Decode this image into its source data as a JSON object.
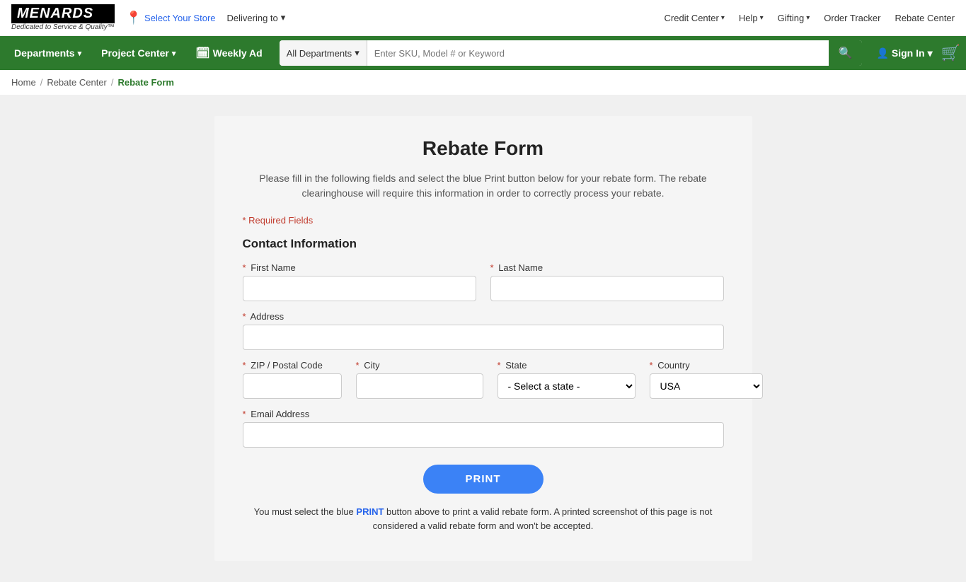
{
  "topbar": {
    "logo": "MENARDS",
    "logo_reg": "®",
    "tagline": "Dedicated to Service & Quality™",
    "store_select": "Select Your Store",
    "delivering_to": "Delivering to",
    "nav_right": [
      {
        "label": "Credit Center",
        "has_chevron": true
      },
      {
        "label": "Help",
        "has_chevron": true
      },
      {
        "label": "Gifting",
        "has_chevron": true
      },
      {
        "label": "Order Tracker",
        "has_chevron": false
      },
      {
        "label": "Rebate Center",
        "has_chevron": false
      }
    ]
  },
  "navbar": {
    "departments": "Departments",
    "project_center": "Project Center",
    "weekly_ad": "Weekly Ad",
    "search_dept": "All Departments",
    "search_placeholder": "Enter SKU, Model # or Keyword",
    "signin": "Sign In"
  },
  "breadcrumb": {
    "home": "Home",
    "rebate_center": "Rebate Center",
    "current": "Rebate Form"
  },
  "form": {
    "title": "Rebate Form",
    "description": "Please fill in the following fields and select the blue Print button below for your rebate form. The rebate clearinghouse will require this information in order to correctly process your rebate.",
    "required_note": "* Required Fields",
    "section_title": "Contact Information",
    "fields": {
      "first_name_label": "First Name",
      "last_name_label": "Last Name",
      "address_label": "Address",
      "zip_label": "ZIP / Postal Code",
      "city_label": "City",
      "state_label": "State",
      "state_placeholder": "- Select a state -",
      "country_label": "Country",
      "country_default": "USA",
      "email_label": "Email Address"
    },
    "print_button": "PRINT",
    "print_note": "You must select the blue PRINT button above to print a valid rebate form. A printed screenshot of this page is not considered a valid rebate form and won't be accepted."
  }
}
